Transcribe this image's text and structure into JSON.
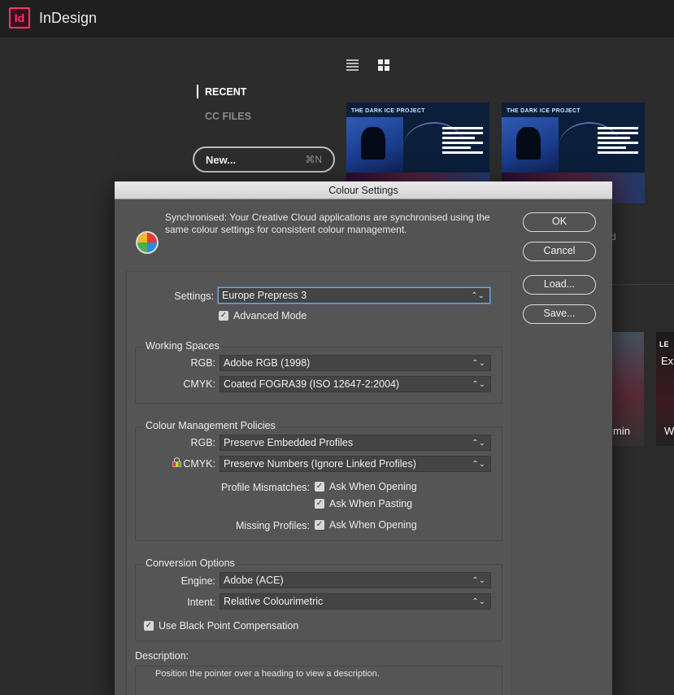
{
  "app": {
    "logo": "Id",
    "title": "InDesign"
  },
  "home": {
    "nav": {
      "recent": "RECENT",
      "cc_files": "CC FILES"
    },
    "new_button": {
      "label": "New...",
      "shortcut": "⌘N"
    },
    "thumbnails": [
      {
        "title": "THE DARK ICE PROJECT"
      },
      {
        "title": "THE DARK ICE PROJECT"
      }
    ],
    "partial_texts": {
      "stray": "d",
      "card_time": "min",
      "card_le": "LE",
      "card_ex": "Ex",
      "card_w": "W"
    }
  },
  "dialog": {
    "title": "Colour Settings",
    "sync_message": "Synchronised: Your Creative Cloud applications are synchronised using the same colour settings for consistent colour management.",
    "buttons": {
      "ok": "OK",
      "cancel": "Cancel",
      "load": "Load...",
      "save": "Save..."
    },
    "settings": {
      "label": "Settings:",
      "value": "Europe Prepress 3",
      "advanced_mode": "Advanced Mode",
      "advanced_checked": true
    },
    "working_spaces": {
      "title": "Working Spaces",
      "rgb_label": "RGB:",
      "rgb_value": "Adobe RGB (1998)",
      "cmyk_label": "CMYK:",
      "cmyk_value": "Coated FOGRA39 (ISO 12647-2:2004)"
    },
    "policies": {
      "title": "Colour Management Policies",
      "rgb_label": "RGB:",
      "rgb_value": "Preserve Embedded Profiles",
      "cmyk_label": "CMYK:",
      "cmyk_value": "Preserve Numbers (Ignore Linked Profiles)",
      "mismatch_label": "Profile Mismatches:",
      "ask_opening": "Ask When Opening",
      "ask_pasting": "Ask When Pasting",
      "missing_label": "Missing Profiles:",
      "missing_ask_opening": "Ask When Opening"
    },
    "conversion": {
      "title": "Conversion Options",
      "engine_label": "Engine:",
      "engine_value": "Adobe (ACE)",
      "intent_label": "Intent:",
      "intent_value": "Relative Colourimetric",
      "black_point": "Use Black Point Compensation"
    },
    "description": {
      "label": "Description:",
      "text": "Position the pointer over a heading to view a description."
    }
  },
  "colors": {
    "accent_logo": "#ff3366",
    "dialog_bg": "#535353",
    "focus_ring": "#7aa7e0"
  }
}
